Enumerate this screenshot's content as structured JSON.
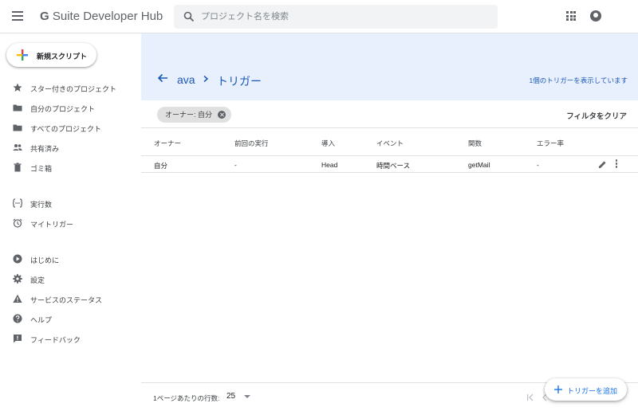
{
  "header": {
    "brand_g": "G",
    "brand_rest": "Suite Developer Hub",
    "search_placeholder": "プロジェクト名を検索"
  },
  "sidebar": {
    "new_script": "新規スクリプト",
    "items": [
      {
        "label": "スター付きのプロジェクト",
        "icon": "star-icon"
      },
      {
        "label": "自分のプロジェクト",
        "icon": "folder-icon"
      },
      {
        "label": "すべてのプロジェクト",
        "icon": "folder-icon"
      },
      {
        "label": "共有済み",
        "icon": "people-icon"
      },
      {
        "label": "ゴミ箱",
        "icon": "trash-icon"
      },
      {
        "label": "実行数",
        "icon": "executions-icon"
      },
      {
        "label": "マイトリガー",
        "icon": "alarm-icon"
      },
      {
        "label": "はじめに",
        "icon": "play-icon"
      },
      {
        "label": "設定",
        "icon": "gear-icon"
      },
      {
        "label": "サービスのステータス",
        "icon": "warning-icon"
      },
      {
        "label": "ヘルプ",
        "icon": "help-icon"
      },
      {
        "label": "フィードバック",
        "icon": "feedback-icon"
      }
    ]
  },
  "banner": {
    "project": "ava",
    "current": "トリガー",
    "count_text": "1個のトリガーを表示しています"
  },
  "filter": {
    "chip": "オーナー: 自分",
    "clear": "フィルタをクリア"
  },
  "table": {
    "headers": [
      "オーナー",
      "前回の実行",
      "導入",
      "イベント",
      "関数",
      "エラー率"
    ],
    "rows": [
      [
        "自分",
        "-",
        "Head",
        "時間ベース",
        "getMail",
        "-"
      ]
    ]
  },
  "footer": {
    "rows_per_page_label": "1ページあたりの行数:",
    "rows_per_page": "25",
    "add_trigger": "トリガーを追加"
  },
  "colors": {
    "accent": "#1a73e8",
    "banner": "#e8f0fe"
  }
}
